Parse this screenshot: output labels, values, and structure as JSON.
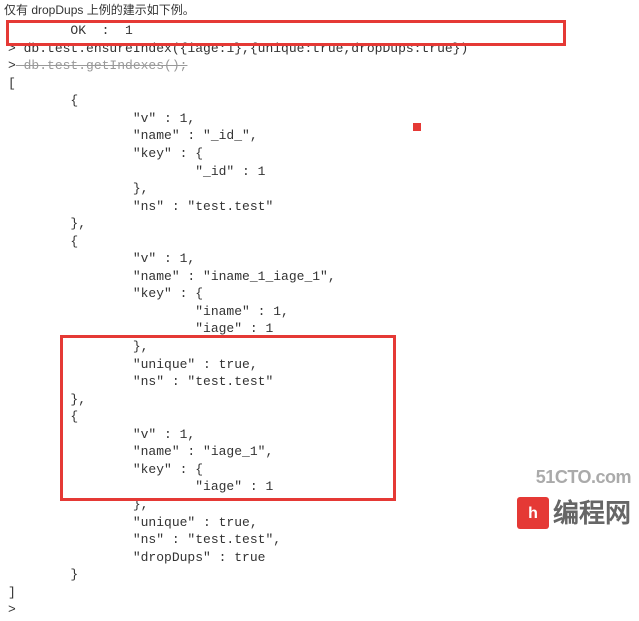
{
  "header_fragment": "仅有 dropDups 上例的建示如下例。",
  "line_ok": "        OK  :  1",
  "prompt": ">",
  "command": " db.test.ensureIndex({iage:1},{unique:true,dropDups:true})",
  "struck_line": " db.test.getIndexes();",
  "code_body": "[\n        {\n                \"v\" : 1,\n                \"name\" : \"_id_\",\n                \"key\" : {\n                        \"_id\" : 1\n                },\n                \"ns\" : \"test.test\"\n        },\n        {\n                \"v\" : 1,\n                \"name\" : \"iname_1_iage_1\",\n                \"key\" : {\n                        \"iname\" : 1,\n                        \"iage\" : 1\n                },\n                \"unique\" : true,\n                \"ns\" : \"test.test\"\n        },\n        {\n                \"v\" : 1,\n                \"name\" : \"iage_1\",\n                \"key\" : {\n                        \"iage\" : 1\n                },\n                \"unique\" : true,\n                \"ns\" : \"test.test\",\n                \"dropDups\" : true\n        }\n]",
  "final_prompt": ">",
  "watermark_top": "51CTO.com",
  "watermark_logo": "h",
  "watermark_text": "编程网"
}
